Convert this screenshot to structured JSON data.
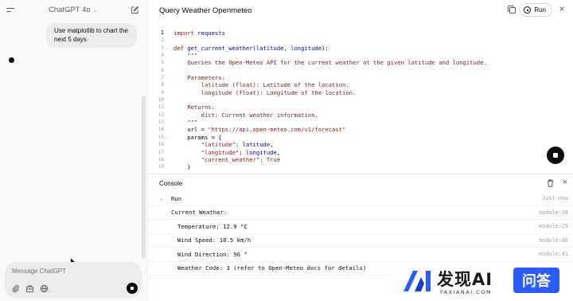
{
  "chat": {
    "model_name": "ChatGPT 4o",
    "user_message": "Use matplotlib to chart the next 5 days",
    "composer_placeholder": "Message ChatGPT"
  },
  "canvas": {
    "title": "Query Weather Openmeteo",
    "run_label": "Run",
    "code_lines": [
      {
        "n": "1",
        "fold": "",
        "html": "<span class=\"kw\">import</span> <span class=\"fn\">requests</span>"
      },
      {
        "n": "2",
        "fold": "",
        "html": ""
      },
      {
        "n": "3",
        "fold": "v",
        "html": "<span class=\"kw\">def</span> <span class=\"fn\">get_current_weather</span>(<span class=\"par\">latitude</span>, <span class=\"par\">longitude</span>):"
      },
      {
        "n": "4",
        "fold": "",
        "html": "    <span class=\"doc\">\"\"\"</span>"
      },
      {
        "n": "5",
        "fold": "",
        "html": "    <span class=\"doc\">Queries the Open-Meteo API for the current weather at the given latitude and longitude.</span>"
      },
      {
        "n": "6",
        "fold": "",
        "html": ""
      },
      {
        "n": "7",
        "fold": "",
        "html": "    <span class=\"doc\">Parameters:</span>"
      },
      {
        "n": "8",
        "fold": "",
        "html": "        <span class=\"doc\">latitude (float): Latitude of the location.</span>"
      },
      {
        "n": "9",
        "fold": "",
        "html": "        <span class=\"doc\">longitude (float): Longitude of the location.</span>"
      },
      {
        "n": "10",
        "fold": "",
        "html": ""
      },
      {
        "n": "11",
        "fold": "",
        "html": "    <span class=\"doc\">Returns:</span>"
      },
      {
        "n": "12",
        "fold": "",
        "html": "        <span class=\"doc\">dict: Current weather information.</span>"
      },
      {
        "n": "13",
        "fold": "",
        "html": "    <span class=\"doc\">\"\"\"</span>"
      },
      {
        "n": "14",
        "fold": "",
        "html": "    url = <span class=\"str\">\"https://api.open-meteo.com/v1/forecast\"</span>"
      },
      {
        "n": "15",
        "fold": "v",
        "html": "    params = {"
      },
      {
        "n": "16",
        "fold": "",
        "html": "        <span class=\"str\">\"latitude\"</span>: <span class=\"par\">latitude</span>,"
      },
      {
        "n": "17",
        "fold": "",
        "html": "        <span class=\"str\">\"longitude\"</span>: <span class=\"par\">longitude</span>,"
      },
      {
        "n": "18",
        "fold": "",
        "html": "        <span class=\"str\">\"current_weather\"</span>: <span class=\"kw\">True</span>"
      },
      {
        "n": "19",
        "fold": "",
        "html": "    }"
      }
    ]
  },
  "console": {
    "title": "Console",
    "rows": [
      {
        "text": "Run",
        "meta": "Just now",
        "indent": 28,
        "caret": true
      },
      {
        "text": "Current Weather:",
        "meta": "module:38",
        "indent": 28,
        "caret": false
      },
      {
        "text": "Temperature: 12.9 °C",
        "meta": "module:29",
        "indent": 36,
        "caret": false
      },
      {
        "text": "Wind Speed: 10.5 km/h",
        "meta": "module:40",
        "indent": 36,
        "caret": false
      },
      {
        "text": "Wind Direction: 96 °",
        "meta": "module:41",
        "indent": 36,
        "caret": false
      },
      {
        "text": "Weather Code: 3 (refer to Open-Meteo docs for details)",
        "meta": "",
        "indent": 36,
        "caret": false
      }
    ]
  },
  "watermark": {
    "brand": "发现AI",
    "domain": "FAXIANAI.COM",
    "badge": "问答"
  }
}
